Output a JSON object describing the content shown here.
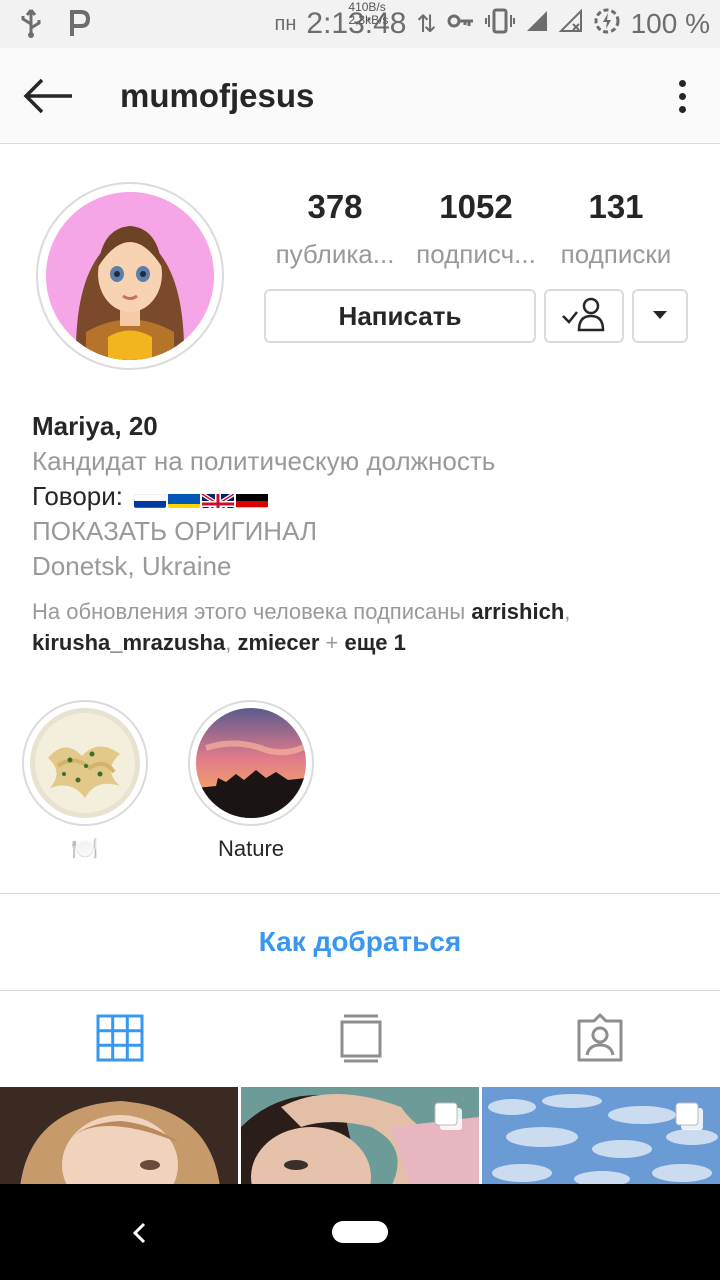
{
  "status_bar": {
    "day": "пн",
    "time": "2:13:48",
    "speed_up": "410B/s",
    "speed_down": "2,3kB/s",
    "battery": "100 %"
  },
  "app_bar": {
    "username": "mumofjesus"
  },
  "stats": [
    {
      "value": "378",
      "label": "публика..."
    },
    {
      "value": "1052",
      "label": "подписч..."
    },
    {
      "value": "131",
      "label": "подписки"
    }
  ],
  "buttons": {
    "message": "Написать"
  },
  "bio": {
    "name": "Mariya, 20",
    "category": "Кандидат на политическую должность",
    "speaks": "Говори:",
    "show_original": "ПОКАЗАТЬ ОРИГИНАЛ",
    "location": "Donetsk, Ukraine",
    "followed_by_prefix": "На обновления этого человека подписаны",
    "followed_users": [
      "arrishich",
      "kirusha_mrazusha",
      "zmiecer"
    ],
    "followed_more": "еще 1"
  },
  "highlights": [
    {
      "label": "🍽️",
      "icon": "plate-icon"
    },
    {
      "label": "Nature"
    }
  ],
  "directions_label": "Как добраться",
  "colors": {
    "accent": "#3897f0",
    "muted_text": "#999999",
    "border": "#dbdbdb",
    "avatar_bg": "#f6a6e6"
  }
}
